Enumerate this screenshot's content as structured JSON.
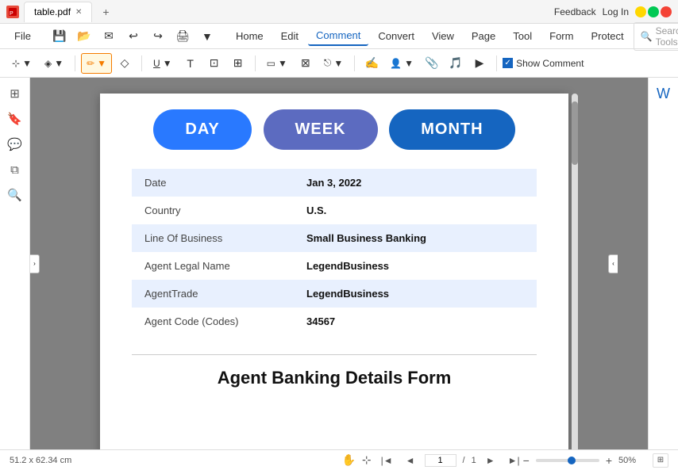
{
  "titleBar": {
    "appIcon": "pdf",
    "tabLabel": "table.pdf",
    "addTab": "+",
    "feedbackLabel": "Feedback",
    "loginLabel": "Log In"
  },
  "menuBar": {
    "items": [
      {
        "label": "File",
        "id": "file"
      },
      {
        "label": "Home",
        "id": "home"
      },
      {
        "label": "Edit",
        "id": "edit"
      },
      {
        "label": "Comment",
        "id": "comment",
        "active": true
      },
      {
        "label": "Convert",
        "id": "convert"
      },
      {
        "label": "View",
        "id": "view"
      },
      {
        "label": "Page",
        "id": "page"
      },
      {
        "label": "Tool",
        "id": "tool"
      },
      {
        "label": "Form",
        "id": "form"
      },
      {
        "label": "Protect",
        "id": "protect"
      }
    ],
    "searchPlaceholder": "Search Tools"
  },
  "toolbar": {
    "showCommentLabel": "Show Comment"
  },
  "pdfContent": {
    "periodButtons": [
      {
        "label": "DAY",
        "type": "day"
      },
      {
        "label": "WEEK",
        "type": "week"
      },
      {
        "label": "MONTH",
        "type": "month"
      }
    ],
    "tableRows": [
      {
        "label": "Date",
        "value": "Jan 3, 2022"
      },
      {
        "label": "Country",
        "value": "U.S."
      },
      {
        "label": "Line Of Business",
        "value": "Small Business Banking"
      },
      {
        "label": "Agent Legal Name",
        "value": "LegendBusiness"
      },
      {
        "label": "AgentTrade",
        "value": "LegendBusiness"
      },
      {
        "label": "Agent Code (Codes)",
        "value": "34567"
      }
    ],
    "formTitle": "Agent Banking Details Form"
  },
  "statusBar": {
    "dimensions": "51.2 x 62.34 cm",
    "pageInfo": "1 / 1",
    "zoomValue": "50%"
  }
}
